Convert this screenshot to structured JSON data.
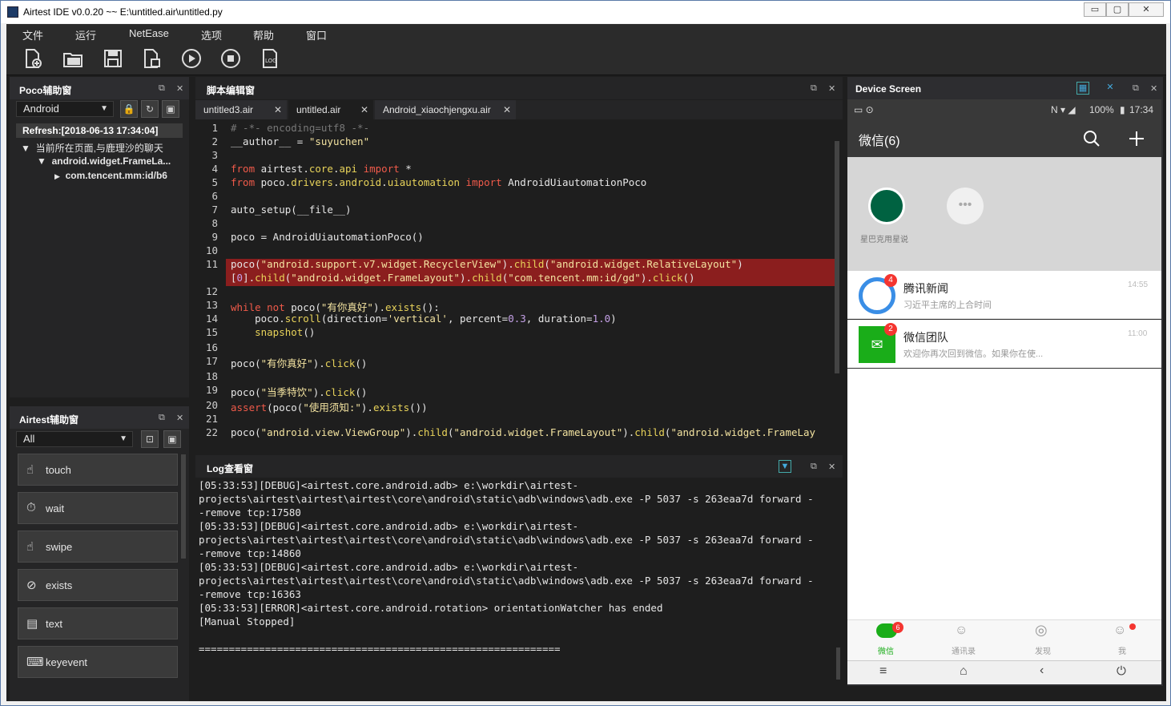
{
  "window": {
    "title": "Airtest IDE v0.0.20 ~~ E:\\untitled.air\\untitled.py",
    "min": "▭",
    "max": "▢",
    "close": "✕"
  },
  "menu": [
    "文件",
    "运行",
    "NetEase",
    "选项",
    "帮助",
    "窗口"
  ],
  "toolbar": {
    "icons": [
      "new-file-icon",
      "open-folder-icon",
      "save-icon",
      "new-script-icon",
      "run-icon",
      "stop-icon",
      "log-icon"
    ]
  },
  "poco": {
    "title": "Poco辅助窗",
    "mode": "Android",
    "refresh": "Refresh:[2018-06-13 17:34:04]",
    "tree": [
      "当前所在页面,与鹿理沙的聊天",
      "android.widget.FrameLa...",
      "com.tencent.mm:id/b6"
    ]
  },
  "airtest": {
    "title": "Airtest辅助窗",
    "filter": "All",
    "buttons": [
      {
        "label": "touch",
        "icon": "☝"
      },
      {
        "label": "wait",
        "icon": "⏱"
      },
      {
        "label": "swipe",
        "icon": "☝"
      },
      {
        "label": "exists",
        "icon": "⊘"
      },
      {
        "label": "text",
        "icon": "▤"
      },
      {
        "label": "keyevent",
        "icon": "⌨"
      }
    ]
  },
  "editor": {
    "title": "脚本编辑窗",
    "tabs": [
      "untitled3.air",
      "untitled.air",
      "Android_xiaochjengxu.air"
    ],
    "line_numbers": [
      "1",
      "2",
      "3",
      "4",
      "5",
      "6",
      "7",
      "8",
      "9",
      "10",
      "11",
      "",
      "12",
      "13",
      "14",
      "15",
      "16",
      "17",
      "18",
      "19",
      "20",
      "21",
      "22"
    ]
  },
  "log": {
    "title": "Log查看窗",
    "lines": [
      "[05:33:53][DEBUG]<airtest.core.android.adb> e:\\workdir\\airtest-",
      "projects\\airtest\\airtest\\airtest\\core\\android\\static\\adb\\windows\\adb.exe -P 5037 -s 263eaa7d forward -",
      "-remove tcp:17580",
      "[05:33:53][DEBUG]<airtest.core.android.adb> e:\\workdir\\airtest-",
      "projects\\airtest\\airtest\\airtest\\core\\android\\static\\adb\\windows\\adb.exe -P 5037 -s 263eaa7d forward -",
      "-remove tcp:14860",
      "[05:33:53][DEBUG]<airtest.core.android.adb> e:\\workdir\\airtest-",
      "projects\\airtest\\airtest\\airtest\\core\\android\\static\\adb\\windows\\adb.exe -P 5037 -s 263eaa7d forward -",
      "-remove tcp:16363",
      "[05:33:53][ERROR]<airtest.core.android.rotation> orientationWatcher has ended",
      "[Manual Stopped]",
      "",
      "============================================================"
    ]
  },
  "device": {
    "title": "Device Screen",
    "status_right": "100%",
    "time": "17:34",
    "app_title": "微信(6)",
    "mini_app": "星巴克用星说",
    "chats": [
      {
        "name": "腾讯新闻",
        "preview": "习近平主席的上合时间",
        "time": "14:55",
        "badge": "4"
      },
      {
        "name": "微信团队",
        "preview": "欢迎你再次回到微信。如果你在使...",
        "time": "11:00",
        "badge": "2"
      }
    ],
    "nav": [
      {
        "label": "微信",
        "badge": "6"
      },
      {
        "label": "通讯录"
      },
      {
        "label": "发现"
      },
      {
        "label": "我"
      }
    ]
  },
  "colors": {
    "accent_red": "#8b1e1e",
    "wechat_green": "#1aad19",
    "bg_dark": "#1e1e1e",
    "panel": "#252526"
  }
}
